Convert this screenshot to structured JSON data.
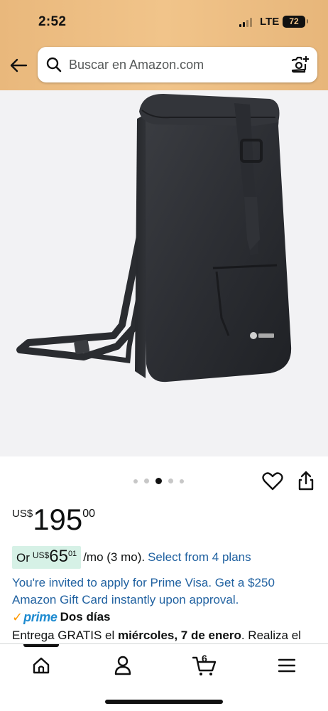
{
  "status_bar": {
    "time": "2:52",
    "network": "LTE",
    "battery": "72"
  },
  "header": {
    "back_icon": "arrow-left-icon",
    "search_icon": "search-icon",
    "search_placeholder": "Buscar en Amazon.com",
    "camera_icon": "camera-search-icon",
    "colors": {
      "header_bg": "#f1c48a"
    }
  },
  "gallery": {
    "image_alt": "black roll-top backpack",
    "dots_count": 5,
    "active_dot": 3
  },
  "actions": {
    "wishlist_icon": "heart-icon",
    "share_icon": "share-icon"
  },
  "pricing": {
    "currency": "US$",
    "whole": "195",
    "fraction": "00",
    "installment": {
      "prefix": "Or",
      "currency": "US$",
      "whole": "65",
      "fraction": "01",
      "per_month": "/mo (3 mo).",
      "plans_link": "Select from 4 plans"
    },
    "promo": "You're invited to apply for Prime Visa. Get a $250 Amazon Gift Card instantly upon approval.",
    "colors": {
      "link": "#2162a1",
      "installment_bg": "#d6f1e6"
    }
  },
  "prime": {
    "check": "✓",
    "label": "prime",
    "speed": "Dos días"
  },
  "delivery": {
    "text_prefix": "Entrega GRATIS el ",
    "date": "miércoles, 7 de enero",
    "text_suffix": ". Realiza el"
  },
  "bottom_nav": {
    "items": [
      {
        "name": "home",
        "icon": "home-icon"
      },
      {
        "name": "account",
        "icon": "person-icon"
      },
      {
        "name": "cart",
        "icon": "cart-icon",
        "count": "6"
      },
      {
        "name": "menu",
        "icon": "menu-icon"
      }
    ]
  }
}
